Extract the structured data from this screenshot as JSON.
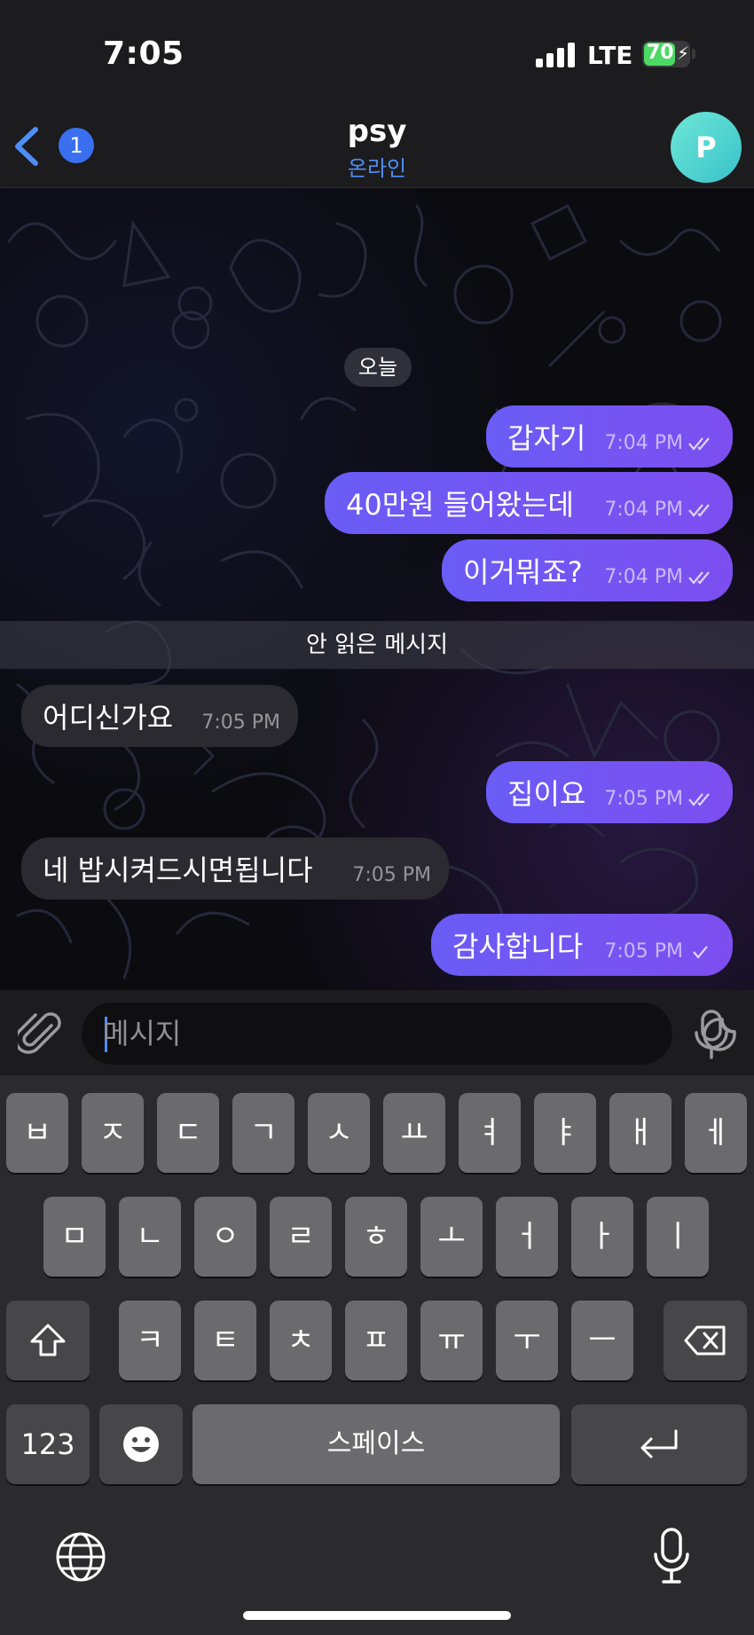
{
  "status_bar": {
    "time": "7:05",
    "network": "LTE",
    "battery": "70",
    "battery_level": 0.7
  },
  "header": {
    "back_badge": "1",
    "title": "psy",
    "status": "온라인",
    "avatar_initial": "P"
  },
  "chat": {
    "date_label": "오늘",
    "unread_label": "안 읽은 메시지",
    "messages": [
      {
        "direction": "out",
        "text": "갑자기",
        "time": "7:04 PM",
        "status": "read"
      },
      {
        "direction": "out",
        "text": "40만원 들어왔는데",
        "time": "7:04 PM",
        "status": "read"
      },
      {
        "direction": "out",
        "text": "이거뭐죠?",
        "time": "7:04 PM",
        "status": "read"
      },
      {
        "direction": "in",
        "text": "어디신가요",
        "time": "7:05 PM"
      },
      {
        "direction": "out",
        "text": "집이요",
        "time": "7:05 PM",
        "status": "read"
      },
      {
        "direction": "in",
        "text": "네 밥시켜드시면됩니다",
        "time": "7:05 PM"
      },
      {
        "direction": "out",
        "text": "감사합니다",
        "time": "7:05 PM",
        "status": "sent"
      }
    ]
  },
  "input": {
    "placeholder": "메시지",
    "value": ""
  },
  "keyboard": {
    "row1": [
      "ㅂ",
      "ㅈ",
      "ㄷ",
      "ㄱ",
      "ㅅ",
      "ㅛ",
      "ㅕ",
      "ㅑ",
      "ㅐ",
      "ㅔ"
    ],
    "row2": [
      "ㅁ",
      "ㄴ",
      "ㅇ",
      "ㄹ",
      "ㅎ",
      "ㅗ",
      "ㅓ",
      "ㅏ",
      "ㅣ"
    ],
    "row3": [
      "ㅋ",
      "ㅌ",
      "ㅊ",
      "ㅍ",
      "ㅠ",
      "ㅜ",
      "ㅡ"
    ],
    "numbers_label": "123",
    "space_label": "스페이스",
    "shift_icon": "shift-icon",
    "delete_icon": "backspace-icon",
    "emoji_icon": "emoji-icon",
    "return_icon": "return-icon"
  },
  "colors": {
    "accent": "#4f8ef7",
    "outgoing_bubble": "#6a5cf5",
    "incoming_bubble": "#2a2a30",
    "avatar": "#39c2c9"
  }
}
